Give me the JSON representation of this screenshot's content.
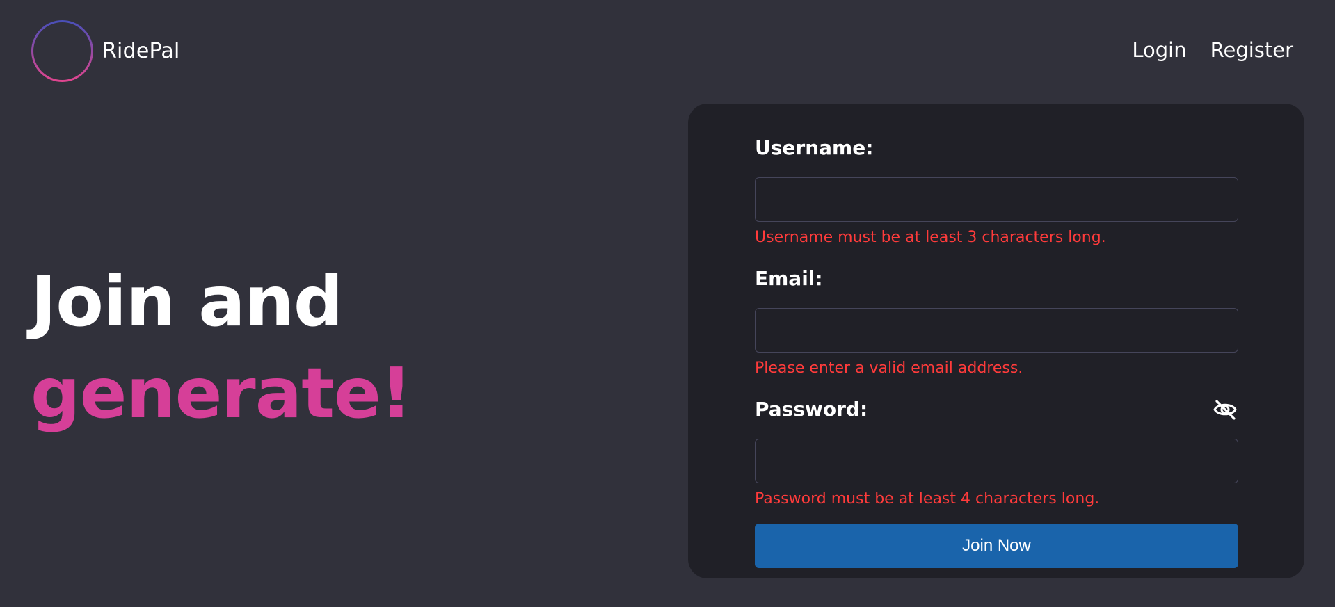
{
  "header": {
    "brand_name": "RidePal",
    "logo_icon": "soundwave-circle-logo",
    "nav": [
      {
        "label": "Login"
      },
      {
        "label": "Register"
      }
    ]
  },
  "hero": {
    "line1": "Join and",
    "line2": "generate!",
    "accent_color": "#d63f98"
  },
  "form": {
    "fields": [
      {
        "label": "Username:",
        "value": "",
        "error": "Username must be at least 3 characters long."
      },
      {
        "label": "Email:",
        "value": "",
        "error": "Please enter a valid email address."
      },
      {
        "label": "Password:",
        "value": "",
        "error": "Password must be at least 4 characters long.",
        "visibility_icon": "eye-slash-icon"
      }
    ],
    "submit_label": "Join Now"
  },
  "colors": {
    "background": "#31313b",
    "panel": "#202027",
    "error": "#ff3b3b",
    "button": "#1a64ab",
    "logo_gradient_start": "#5b4fb0",
    "logo_gradient_end": "#e0458f"
  }
}
